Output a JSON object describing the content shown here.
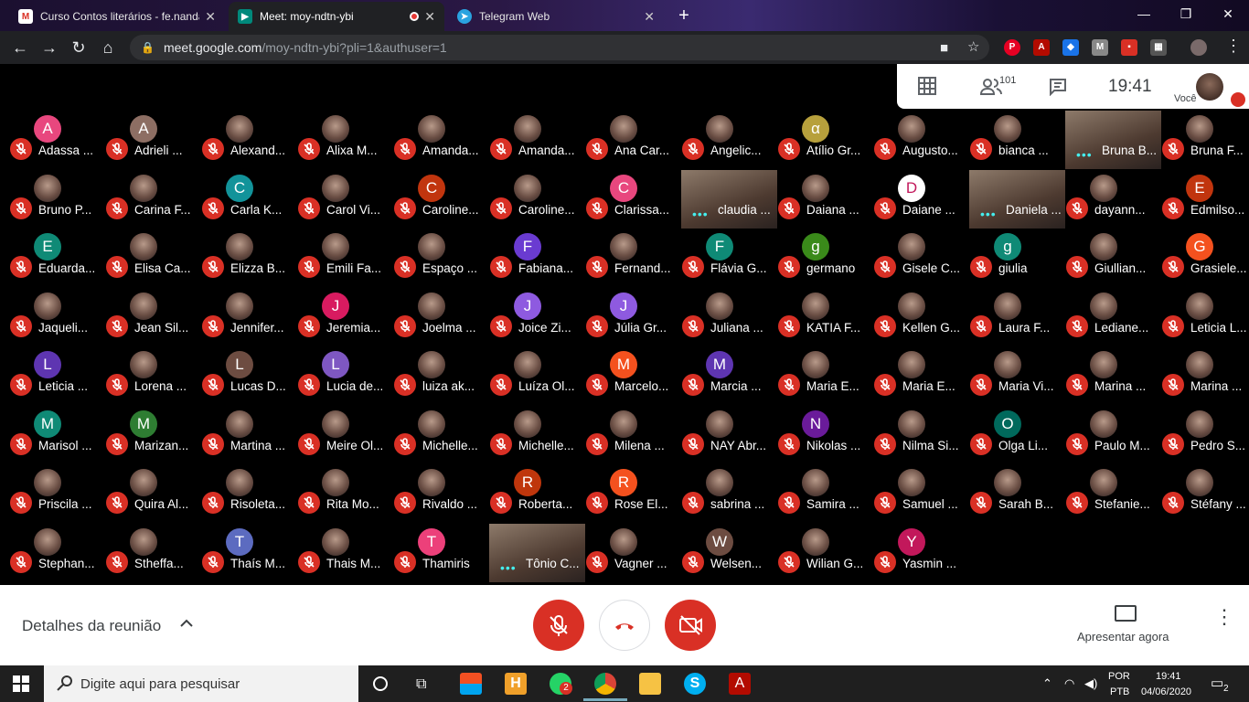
{
  "browser": {
    "tabs": [
      {
        "title": "Curso Contos literários - fe.nanda",
        "favicon": "gmail-icon"
      },
      {
        "title": "Meet: moy-ndtn-ybi",
        "favicon": "meet-icon"
      },
      {
        "title": "Telegram Web",
        "favicon": "telegram-icon"
      }
    ],
    "url_host": "meet.google.com",
    "url_path": "/moy-ndtn-ybi?pli=1&authuser=1"
  },
  "meet": {
    "participant_count": "101",
    "time": "19:41",
    "self_label": "Você",
    "participants": [
      "Adassa ...",
      "Adrieli ...",
      "Alexand...",
      "Alixa M...",
      "Amanda...",
      "Amanda...",
      "Ana Car...",
      "Angelic...",
      "Atílio Gr...",
      "Augusto...",
      "bianca ...",
      "Bruna B...",
      "Bruna F...",
      "Bruno P...",
      "Carina F...",
      "Carla K...",
      "Carol Vi...",
      "Caroline...",
      "Caroline...",
      "Clarissa...",
      "claudia ...",
      "Daiana ...",
      "Daiane ...",
      "Daniela ...",
      "dayann...",
      "Edmilso...",
      "Eduarda...",
      "Elisa Ca...",
      "Elizza B...",
      "Emili Fa...",
      "Espaço ...",
      "Fabiana...",
      "Fernand...",
      "Flávia G...",
      "germano",
      "Gisele C...",
      "giulia",
      "Giullian...",
      "Grasiele...",
      "Jaqueli...",
      "Jean Sil...",
      "Jennifer...",
      "Jeremia...",
      "Joelma ...",
      "Joice Zi...",
      "Júlia Gr...",
      "Juliana ...",
      "KATIA F...",
      "Kellen G...",
      "Laura F...",
      "Lediane...",
      "Leticia L...",
      "Leticia ...",
      "Lorena ...",
      "Lucas D...",
      "Lucia de...",
      "luiza ak...",
      "Luíza Ol...",
      "Marcelo...",
      "Marcia ...",
      "Maria E...",
      "Maria E...",
      "Maria Vi...",
      "Marina ...",
      "Marina ...",
      "Marisol ...",
      "Marizan...",
      "Martina ...",
      "Meire Ol...",
      "Michelle...",
      "Michelle...",
      "Milena ...",
      "NAY Abr...",
      "Nikolas ...",
      "Nilma Si...",
      "Olga Li...",
      "Paulo M...",
      "Pedro S...",
      "Priscila ...",
      "Quira Al...",
      "Risoleta...",
      "Rita Mo...",
      "Rivaldo ...",
      "Roberta...",
      "Rose El...",
      "sabrina ...",
      "Samira ...",
      "Samuel ...",
      "Sarah B...",
      "Stefanie...",
      "Stéfany ...",
      "Stephan...",
      "Stheffa...",
      "Thaís M...",
      "Thais M...",
      "Thamiris",
      "Tônio C...",
      "Vagner ...",
      "Welsen...",
      "Wilian G...",
      "Yasmin ..."
    ],
    "avatars": [
      "A",
      "A",
      "",
      "",
      "",
      "",
      "",
      "",
      "α",
      "",
      "",
      "",
      "",
      "",
      "",
      "C",
      "",
      "C",
      "",
      "C",
      "",
      "",
      "D",
      "",
      "",
      "E",
      "E",
      "",
      "",
      "",
      "",
      "F",
      "",
      "F",
      "g",
      "",
      "g",
      "",
      "G",
      "",
      "",
      "",
      "J",
      "",
      "J",
      "J",
      "",
      "",
      "",
      "",
      "",
      "",
      "L",
      "",
      "L",
      "L",
      "",
      "",
      "M",
      "M",
      "",
      "",
      "",
      "",
      "",
      "M",
      "M",
      "",
      "",
      "",
      "",
      "",
      "",
      "N",
      "",
      "O",
      "",
      "",
      "",
      "",
      "",
      "",
      "",
      "R",
      "R",
      "",
      "",
      "",
      "",
      "",
      "",
      "",
      "",
      "T",
      "",
      "T",
      "",
      "",
      "W",
      "",
      "Y"
    ],
    "avatar_colors": [
      "#e8477e",
      "#8d6e63",
      "",
      "",
      "",
      "",
      "",
      "",
      "#b7a03c",
      "",
      "",
      "",
      "",
      "",
      "",
      "#12939a",
      "",
      "#c1350e",
      "",
      "#e8477e",
      "",
      "",
      "#ffffff",
      "",
      "",
      "#c1350e",
      "#0f8a76",
      "",
      "",
      "",
      "",
      "#6a3bd1",
      "",
      "#0f8a76",
      "#3a8a1a",
      "",
      "#0f8a76",
      "",
      "#f4511e",
      "",
      "",
      "",
      "#d81b60",
      "",
      "#8e5ae0",
      "#8e5ae0",
      "",
      "",
      "",
      "",
      "",
      "",
      "#5e35b1",
      "",
      "#6d4c41",
      "#7e57c2",
      "",
      "",
      "#f4511e",
      "#5e35b1",
      "",
      "",
      "",
      "",
      "",
      "#0f8a76",
      "#2e7d32",
      "",
      "",
      "",
      "",
      "",
      "",
      "#6a1b9a",
      "",
      "#00695c",
      "",
      "",
      "",
      "",
      "",
      "",
      "",
      "#bf360c",
      "#f4511e",
      "",
      "",
      "",
      "",
      "",
      "",
      "",
      "",
      "#5c6bc0",
      "",
      "#ec407a",
      "",
      "",
      "#6d4c41",
      "",
      "#c2185b"
    ],
    "video_tiles": [
      "Bruna B...",
      "claudia ...",
      "Daniela ...",
      "Tônio C..."
    ],
    "details_label": "Detalhes da reunião",
    "present_label": "Apresentar agora"
  },
  "taskbar": {
    "search_placeholder": "Digite aqui para pesquisar",
    "lang_top": "POR",
    "lang_bottom": "PTB",
    "clock_time": "19:41",
    "clock_date": "04/06/2020",
    "whatsapp_badge": "2",
    "notif_count": "2"
  }
}
